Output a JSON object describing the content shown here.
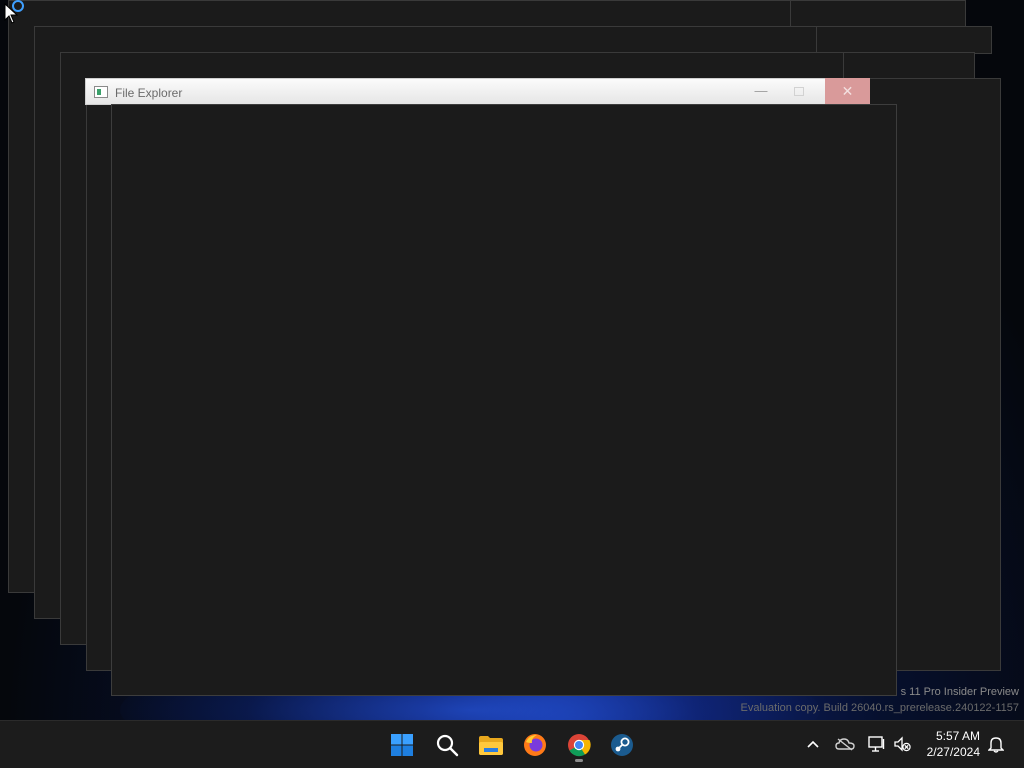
{
  "window": {
    "title": "File Explorer",
    "minimize_glyph": "—",
    "close_glyph": "✕"
  },
  "watermark": {
    "line1": "s 11 Pro Insider Preview",
    "line2": "Evaluation copy. Build 26040.rs_prerelease.240122-1157"
  },
  "taskbar": {
    "apps": [
      {
        "name": "start-icon",
        "pinned": true
      },
      {
        "name": "search-icon",
        "pinned": true
      },
      {
        "name": "file-explorer-icon",
        "pinned": true
      },
      {
        "name": "firefox-icon",
        "pinned": true
      },
      {
        "name": "chrome-icon",
        "pinned": true,
        "running": true
      },
      {
        "name": "steam-icon",
        "pinned": true
      }
    ],
    "tray_icons": [
      "chevron-up-icon",
      "onedrive-icon",
      "network-icon",
      "volume-muted-icon",
      "notification-bell-icon"
    ],
    "clock": {
      "time": "5:57 AM",
      "date": "2/27/2024"
    }
  },
  "colors": {
    "taskbar_bg": "#1c1c1c",
    "window_bg": "#1b1b1b",
    "close_hover": "#d99a9a",
    "accent_blue": "#2f7de1"
  }
}
